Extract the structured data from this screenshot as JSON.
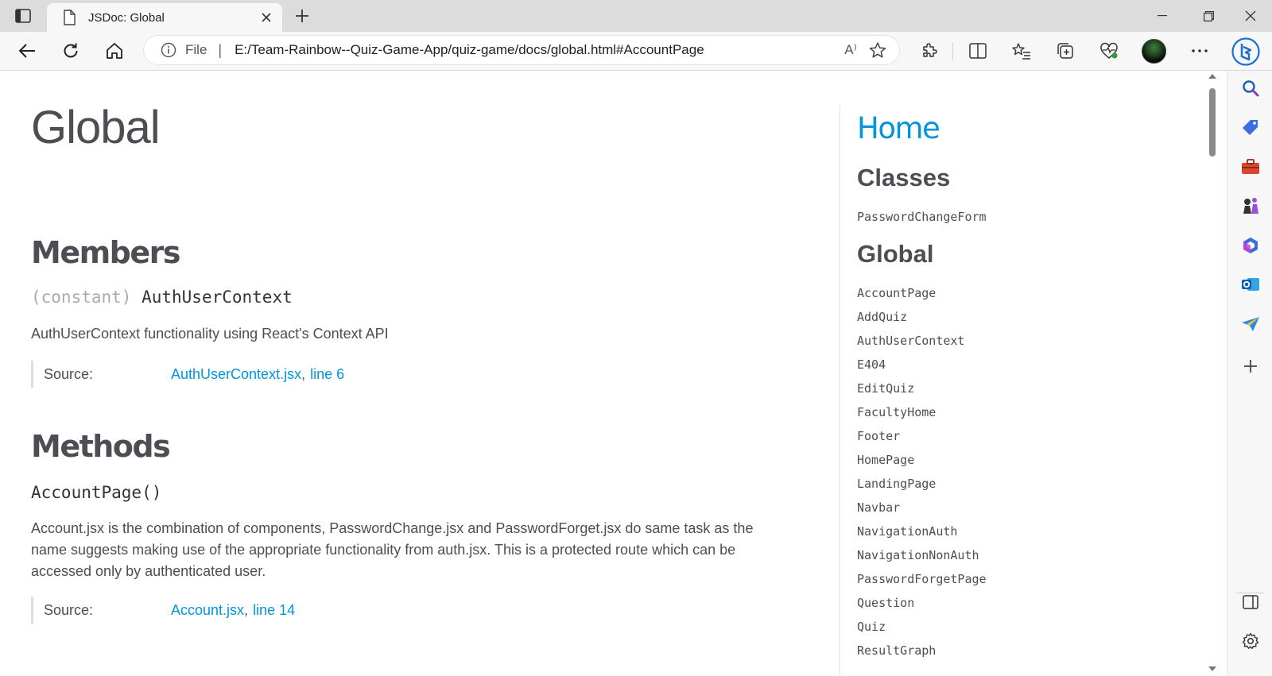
{
  "browser": {
    "tab_title": "JSDoc: Global",
    "address": {
      "scheme_label": "File",
      "separator": "|",
      "url": "E:/Team-Rainbow--Quiz-Game-App/quiz-game/docs/global.html#AccountPage",
      "read_aloud_label": "A⁾"
    }
  },
  "page": {
    "title": "Global",
    "members_heading": "Members",
    "member": {
      "attribute": "(constant)",
      "name": "AuthUserContext",
      "description": "AuthUserContext functionality using React's Context API",
      "source_label": "Source:",
      "source_file": "AuthUserContext.jsx",
      "source_comma": ",",
      "source_line": "line 6"
    },
    "methods_heading": "Methods",
    "method": {
      "signature": "AccountPage()",
      "description": "Account.jsx is the combination of components, PasswordChange.jsx and PasswordForget.jsx do same task as the name suggests making use of the appropriate functionality from auth.jsx. This is a protected route which can be accessed only by authenticated user.",
      "source_label": "Source:",
      "source_file": "Account.jsx",
      "source_comma": ",",
      "source_line": "line 14"
    }
  },
  "nav": {
    "home": "Home",
    "classes_heading": "Classes",
    "classes": [
      "PasswordChangeForm"
    ],
    "global_heading": "Global",
    "globals": [
      "AccountPage",
      "AddQuiz",
      "AuthUserContext",
      "E404",
      "EditQuiz",
      "FacultyHome",
      "Footer",
      "HomePage",
      "LandingPage",
      "Navbar",
      "NavigationAuth",
      "NavigationNonAuth",
      "PasswordForgetPage",
      "Question",
      "Quiz",
      "ResultGraph"
    ]
  },
  "colors": {
    "link": "#0095dd",
    "text": "#4d4e53",
    "muted_attr": "#aaaaaa"
  }
}
